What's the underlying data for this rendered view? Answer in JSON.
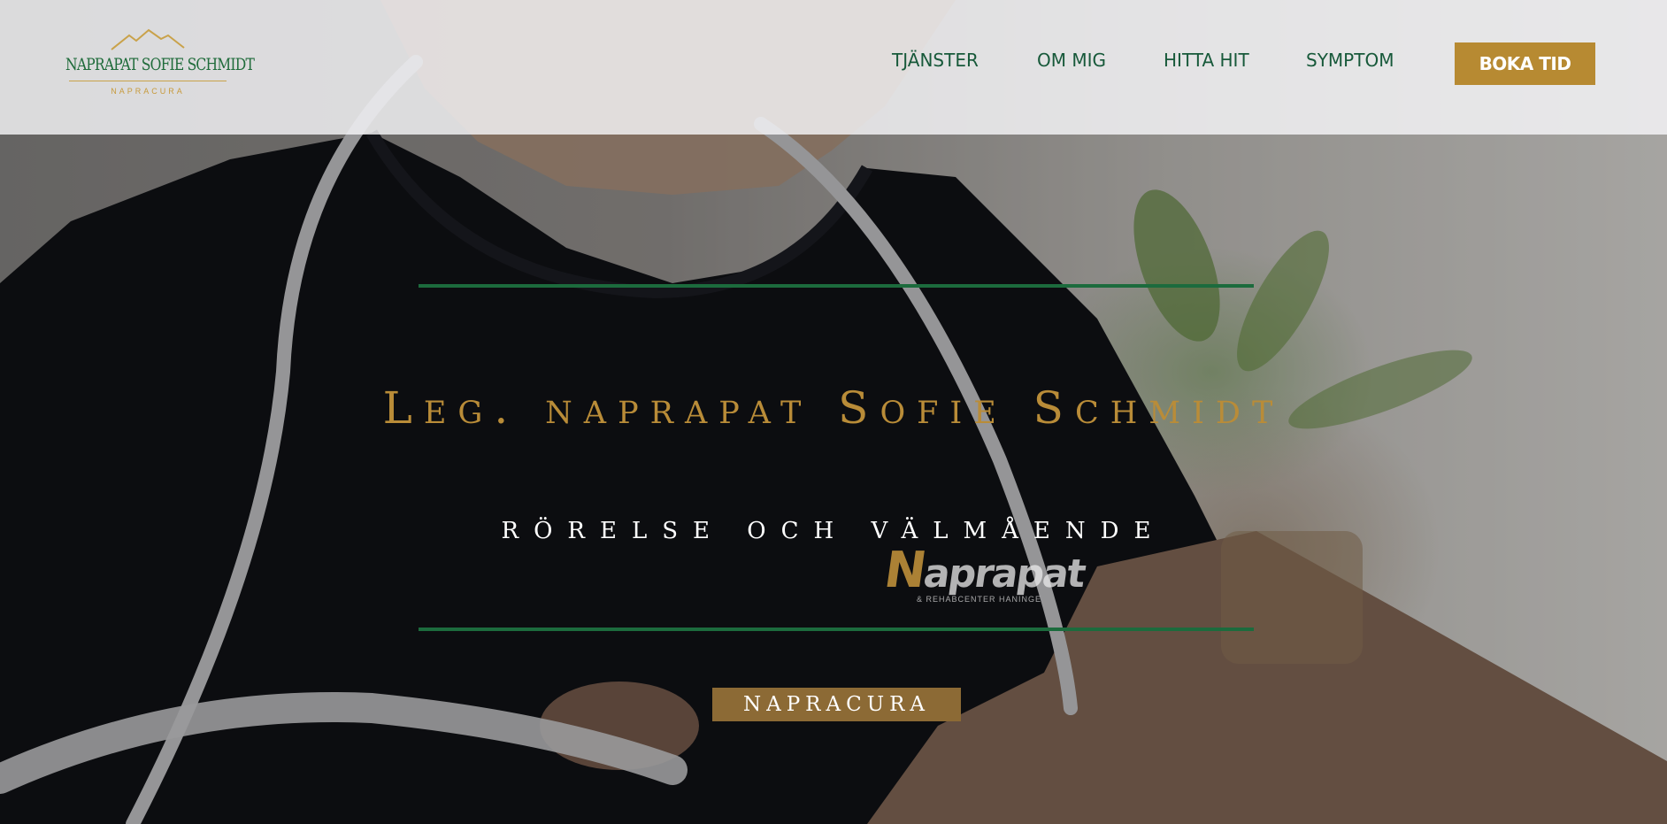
{
  "header": {
    "logo": {
      "name": "NAPRAPAT SOFIE SCHMIDT",
      "subtitle": "NAPRACURA"
    },
    "nav": [
      {
        "label": "TJÄNSTER"
      },
      {
        "label": "OM MIG"
      },
      {
        "label": "HITTA HIT"
      },
      {
        "label": "SYMPTOM"
      }
    ],
    "cta_label": "BOKA TID"
  },
  "hero": {
    "title": "Leg. naprapat Sofie Schmidt",
    "subtitle": "RÖRELSE OCH VÄLMÅENDE",
    "button_label": "NAPRACURA",
    "shirt_logo": {
      "initial": "N",
      "text": "aprapat",
      "sub": "& REHABCENTER HANINGE"
    }
  },
  "colors": {
    "brand_green": "#1c6b3d",
    "brand_gold": "#b78a32",
    "header_bg": "#e8e8ea"
  },
  "icons": {
    "logo_mark": "mountain-icon"
  }
}
